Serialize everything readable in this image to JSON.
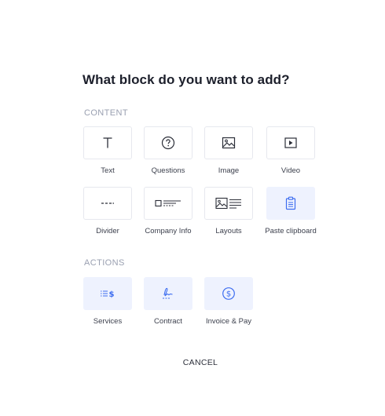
{
  "dialog": {
    "title": "What block do you want to add?",
    "cancel_label": "CANCEL"
  },
  "sections": {
    "content": {
      "label": "CONTENT",
      "items": [
        {
          "label": "Text",
          "icon": "text-icon"
        },
        {
          "label": "Questions",
          "icon": "question-circle-icon"
        },
        {
          "label": "Image",
          "icon": "image-icon"
        },
        {
          "label": "Video",
          "icon": "video-play-icon"
        },
        {
          "label": "Divider",
          "icon": "divider-icon"
        },
        {
          "label": "Company Info",
          "icon": "company-info-icon"
        },
        {
          "label": "Layouts",
          "icon": "layouts-icon"
        },
        {
          "label": "Paste clipboard",
          "icon": "clipboard-icon"
        }
      ]
    },
    "actions": {
      "label": "ACTIONS",
      "items": [
        {
          "label": "Services",
          "icon": "services-list-icon"
        },
        {
          "label": "Contract",
          "icon": "signature-icon"
        },
        {
          "label": "Invoice & Pay",
          "icon": "dollar-circle-icon"
        }
      ]
    }
  },
  "colors": {
    "accent": "#3d6df0",
    "tile_highlight_bg": "#eef2fe",
    "tile_border": "#e6e8ee",
    "section_label": "#9aa0b1"
  }
}
